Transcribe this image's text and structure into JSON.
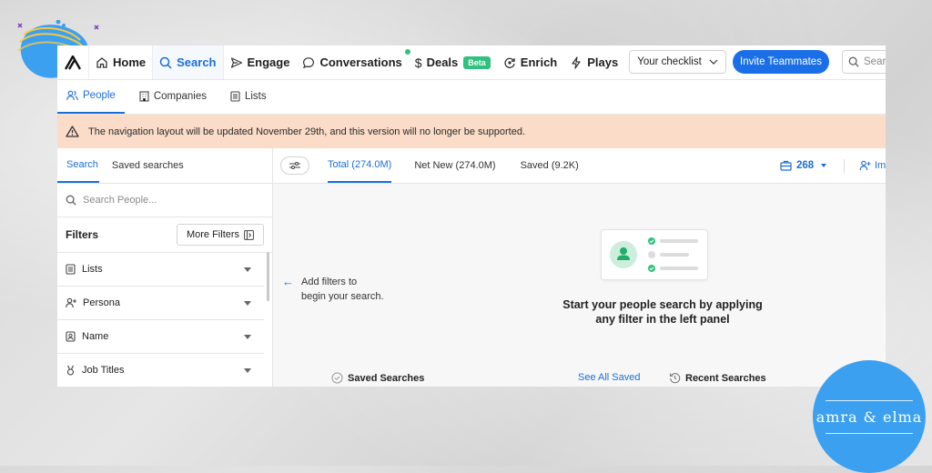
{
  "nav": {
    "items": [
      {
        "label": "Home",
        "icon": "home-icon"
      },
      {
        "label": "Search",
        "icon": "search-icon",
        "active": true
      },
      {
        "label": "Engage",
        "icon": "send-icon"
      },
      {
        "label": "Conversations",
        "icon": "chat-bubble-icon",
        "status": "green-dot"
      },
      {
        "label": "Deals",
        "icon": "dollar-icon",
        "badge": "Beta"
      },
      {
        "label": "Enrich",
        "icon": "refresh-icon"
      },
      {
        "label": "Plays",
        "icon": "lightning-icon"
      }
    ],
    "checklist_label": "Your checklist",
    "invite_label": "Invite Teammates",
    "search_placeholder": "Searc"
  },
  "subnav": {
    "tabs": [
      {
        "label": "People",
        "icon": "people-icon",
        "active": true
      },
      {
        "label": "Companies",
        "icon": "building-icon"
      },
      {
        "label": "Lists",
        "icon": "list-icon"
      }
    ]
  },
  "banner": {
    "text": "The navigation layout will be updated November 29th, and this version will no longer be supported.",
    "icon": "warning-icon"
  },
  "left_panel": {
    "tabs": [
      {
        "label": "Search",
        "active": true
      },
      {
        "label": "Saved searches"
      }
    ],
    "search_placeholder": "Search People...",
    "filters_title": "Filters",
    "more_filters_label": "More Filters",
    "filters": [
      {
        "label": "Lists",
        "icon": "list-icon"
      },
      {
        "label": "Persona",
        "icon": "person-plus-icon"
      },
      {
        "label": "Name",
        "icon": "id-badge-icon"
      },
      {
        "label": "Job Titles",
        "icon": "medal-icon"
      }
    ]
  },
  "main": {
    "tabs": [
      {
        "label": "Total (274.0M)",
        "active": true
      },
      {
        "label": "Net New (274.0M)"
      },
      {
        "label": "Saved (9.2K)"
      }
    ],
    "credits": "268",
    "import_label": "Im",
    "hint": [
      "Add filters to",
      "begin your search."
    ],
    "empty_title": [
      "Start your people search by applying",
      "any filter in the left panel"
    ],
    "saved_searches_label": "Saved Searches",
    "see_all_saved_label": "See All Saved",
    "recent_searches_label": "Recent Searches"
  },
  "brand": {
    "text": "amra & elma"
  },
  "colors": {
    "accent": "#1a6fd6",
    "invite_button": "#1a6fe8",
    "banner_bg": "#fbdcc8",
    "success": "#2fc17d",
    "brand_circle": "#3ca0f0"
  }
}
